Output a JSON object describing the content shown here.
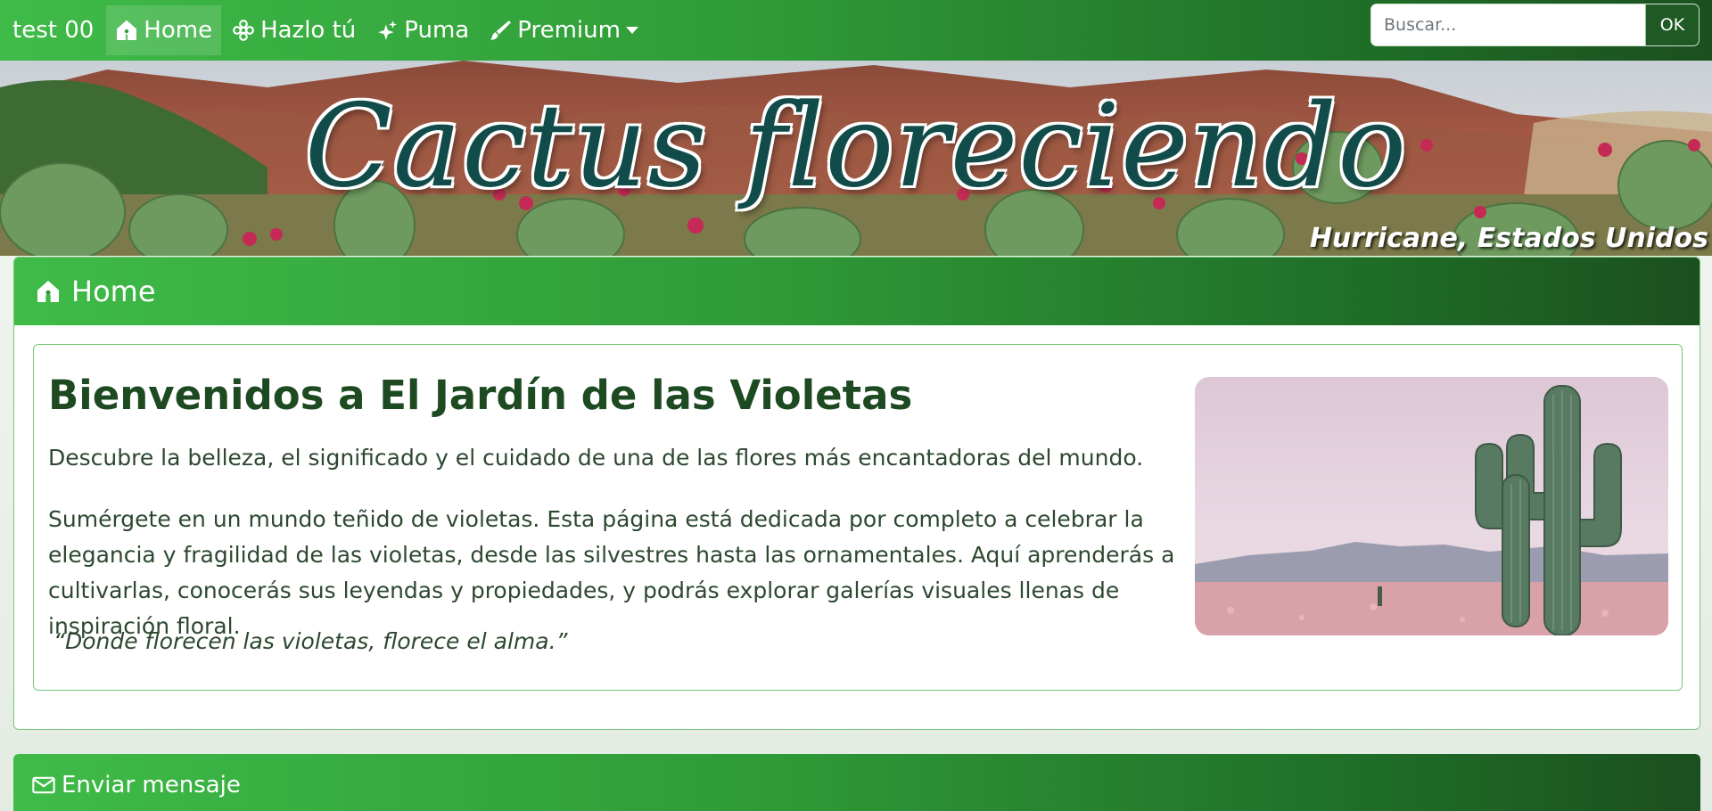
{
  "navbar": {
    "brand": "test 00",
    "items": [
      {
        "label": "Home",
        "icon": "house-icon",
        "active": true
      },
      {
        "label": "Hazlo tú",
        "icon": "flower-icon"
      },
      {
        "label": "Puma",
        "icon": "sparkles-icon"
      },
      {
        "label": "Premium",
        "icon": "brush-icon",
        "dropdown": true
      }
    ],
    "search": {
      "placeholder": "Buscar...",
      "button_label": "OK"
    }
  },
  "banner": {
    "title": "Cactus floreciendo",
    "subtitle": "Hurricane, Estados Unidos"
  },
  "home_card": {
    "header_label": "Home",
    "header_icon": "house-icon",
    "welcome_title": "Bienvenidos a El Jardín de las Violetas",
    "intro": "Descubre la belleza, el significado y el cuidado de una de las flores más encantadoras del mundo.",
    "description": "Sumérgete en un mundo teñido de violetas. Esta página está dedicada por completo a celebrar la elegancia y fragilidad de las violetas, desde las silvestres hasta las ornamentales. Aquí aprenderás a cultivarlas, conocerás sus leyendas y propiedades, y podrás explorar galerías visuales llenas de inspiración floral.",
    "quote": "“Donde florecen las violetas, florece el alma.”"
  },
  "message_card": {
    "header_label": "Enviar mensaje",
    "header_icon": "envelope-icon"
  },
  "colors": {
    "primary_green": "#3fbb48",
    "dark_green": "#1b4f1f",
    "title_green": "#1d4a21",
    "border_green": "#79c879"
  }
}
